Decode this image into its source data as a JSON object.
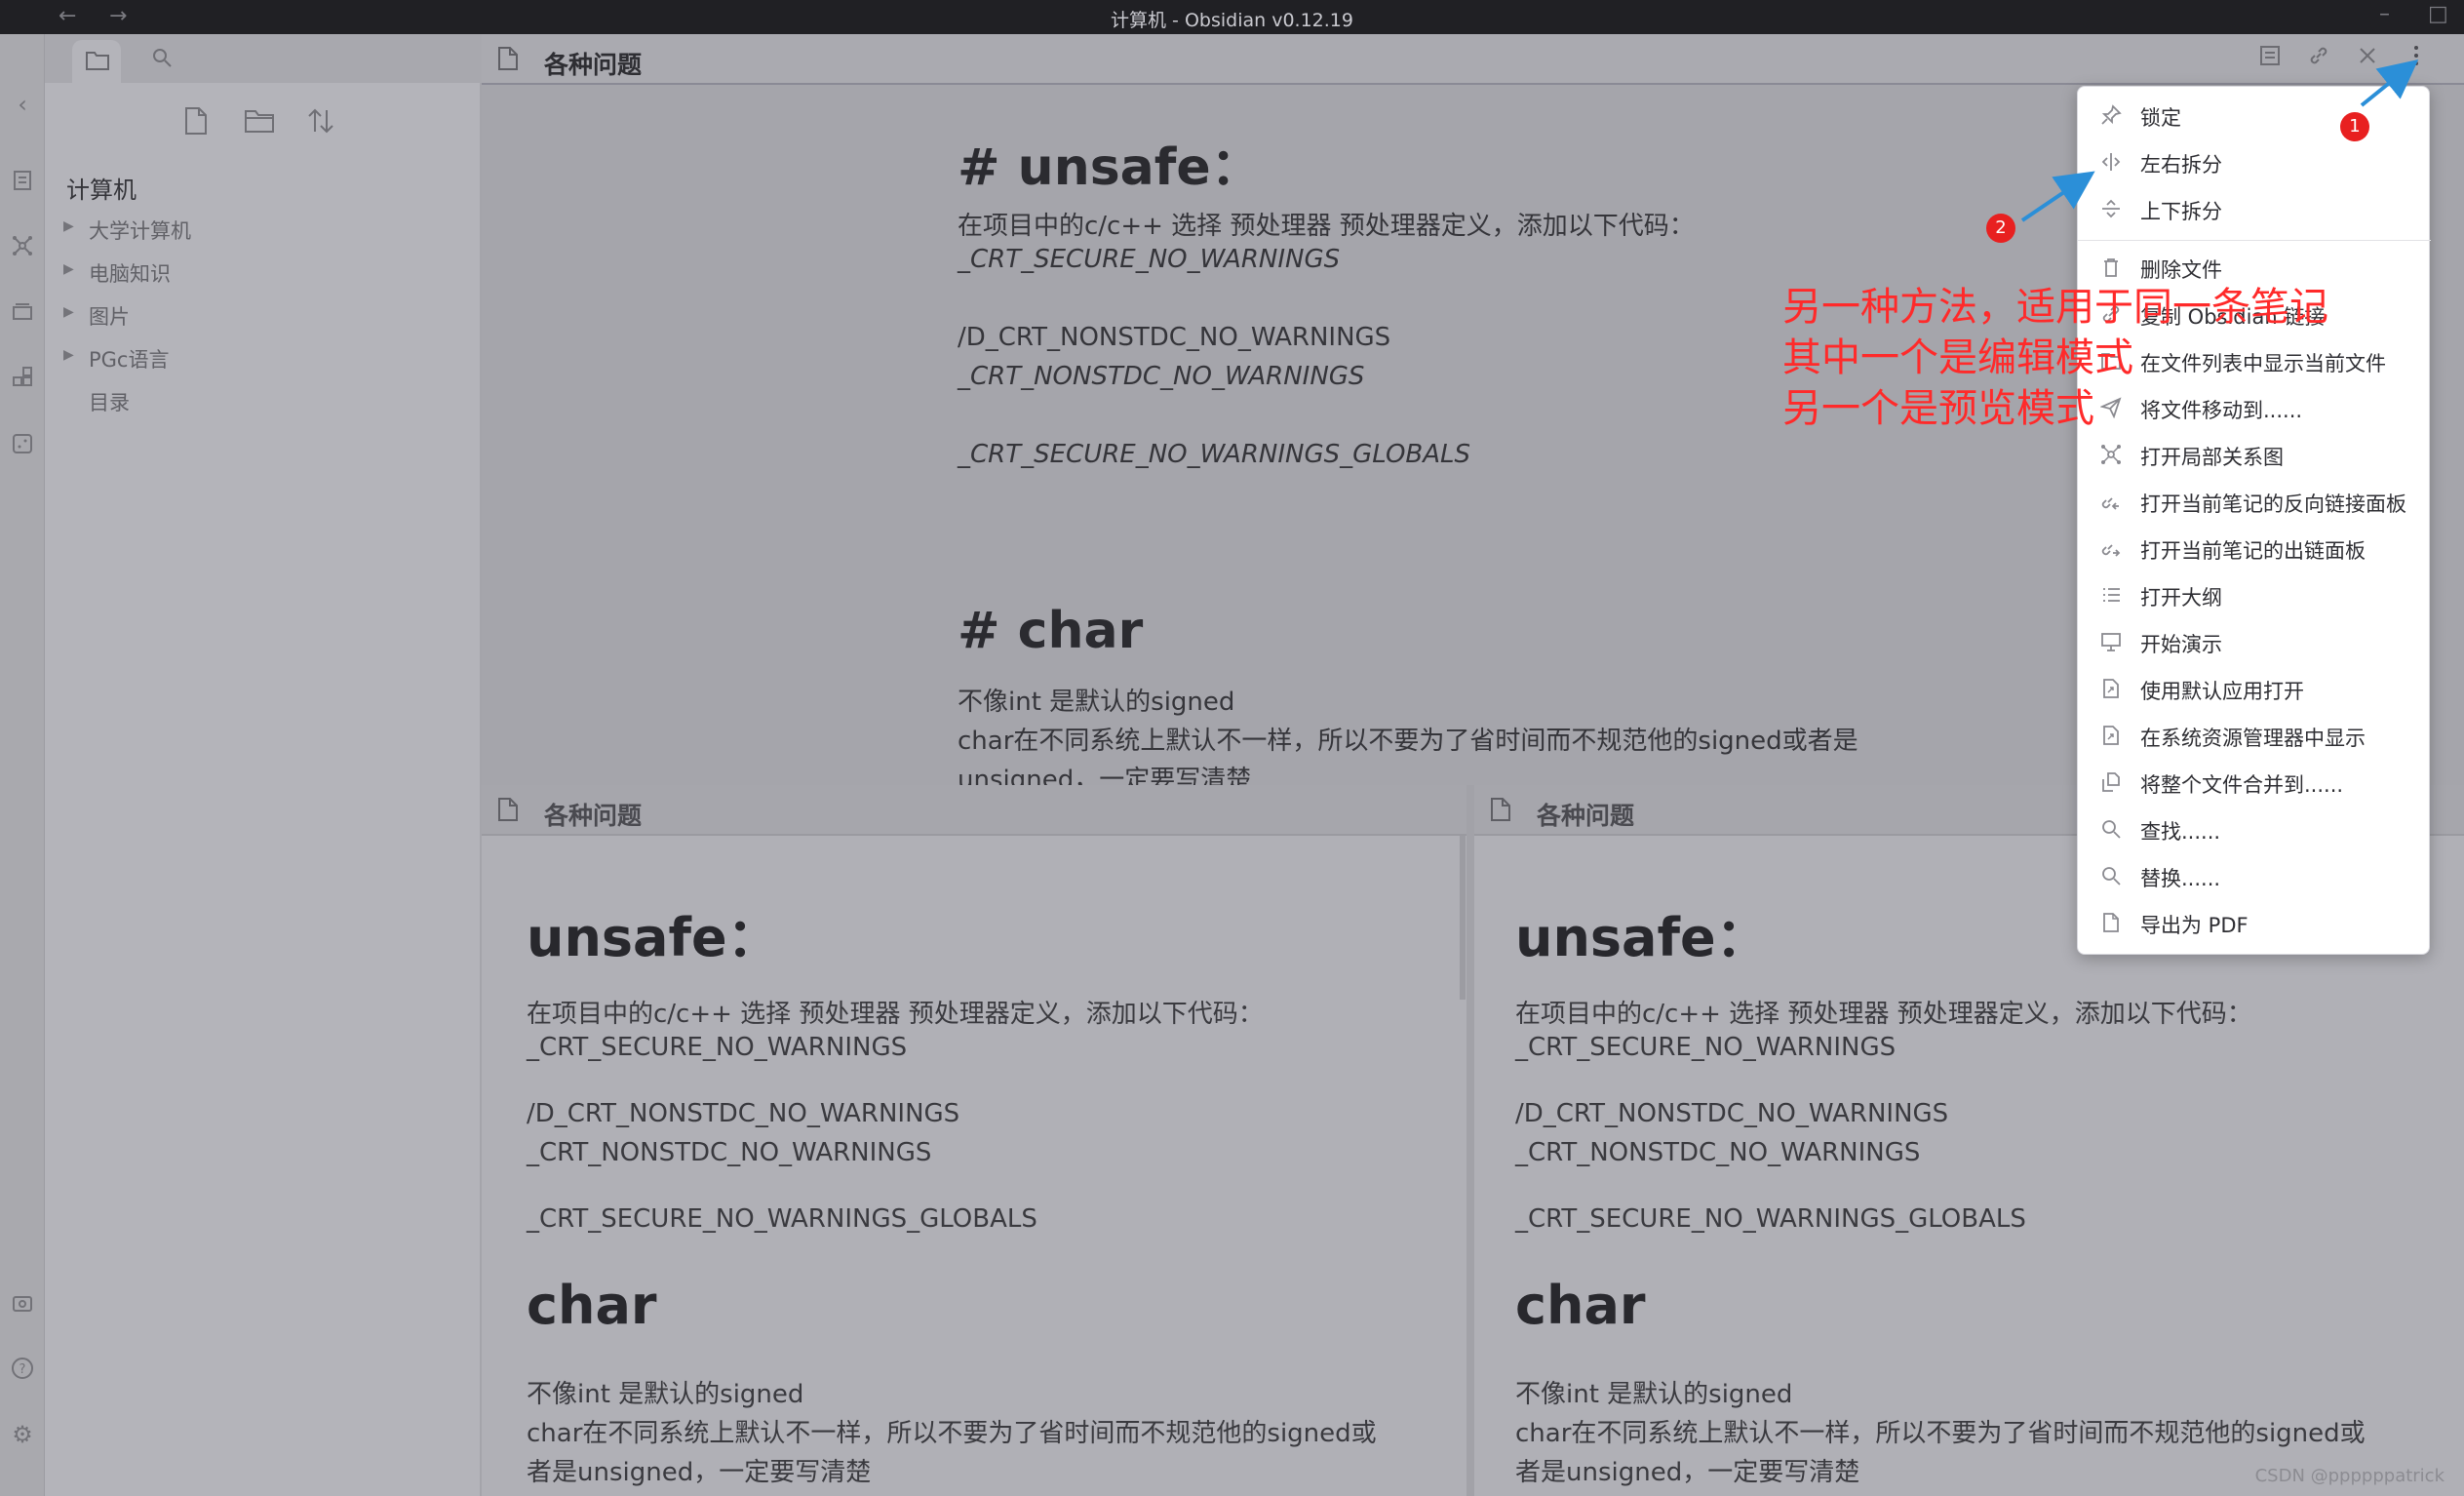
{
  "window": {
    "title": "计算机 - Obsidian v0.12.19",
    "back": "←",
    "forward": "→"
  },
  "sidebar": {
    "vault_name": "计算机",
    "items": [
      {
        "label": "大学计算机",
        "collapsed": true
      },
      {
        "label": "电脑知识",
        "collapsed": true
      },
      {
        "label": "图片",
        "collapsed": true
      },
      {
        "label": "PGc语言",
        "collapsed": true
      },
      {
        "label": "目录",
        "collapsed": false
      }
    ]
  },
  "top_pane": {
    "title": "各种问题",
    "lines": {
      "h_unsafe": "# unsafe：",
      "p1": "在项目中的c/c++ 选择 预处理器 预处理器定义，添加以下代码：",
      "p2": "_CRT_SECURE_NO_WARNINGS",
      "p3": "/D_CRT_NONSTDC_NO_WARNINGS",
      "p4": "_CRT_NONSTDC_NO_WARNINGS",
      "p5": "_CRT_SECURE_NO_WARNINGS_GLOBALS",
      "h_char": "# char",
      "p6": "不像int 是默认的signed",
      "p7": "char在不同系统上默认不一样，所以不要为了省时间而不规范他的signed或者是",
      "p8": "unsigned，一定要写清楚"
    }
  },
  "bottom_left": {
    "title": "各种问题",
    "h_unsafe": "unsafe：",
    "p1": "在项目中的c/c++ 选择 预处理器 预处理器定义，添加以下代码：",
    "p2": "_CRT_SECURE_NO_WARNINGS",
    "p3": "/D_CRT_NONSTDC_NO_WARNINGS",
    "p4": "_CRT_NONSTDC_NO_WARNINGS",
    "p5": "_CRT_SECURE_NO_WARNINGS_GLOBALS",
    "h_char": "char",
    "p6": "不像int 是默认的signed",
    "p7": "char在不同系统上默认不一样，所以不要为了省时间而不规范他的signed或",
    "p8": "者是unsigned，一定要写清楚"
  },
  "bottom_right": {
    "title": "各种问题",
    "h_unsafe": "unsafe：",
    "p1": "在项目中的c/c++ 选择 预处理器 预处理器定义，添加以下代码：",
    "p2": "_CRT_SECURE_NO_WARNINGS",
    "p3": "/D_CRT_NONSTDC_NO_WARNINGS",
    "p4": "_CRT_NONSTDC_NO_WARNINGS",
    "p5": "_CRT_SECURE_NO_WARNINGS_GLOBALS",
    "h_char": "char",
    "p6": "不像int 是默认的signed",
    "p7": "char在不同系统上默认不一样，所以不要为了省时间而不规范他的signed或",
    "p8": "者是unsigned，一定要写清楚"
  },
  "menu": {
    "items": [
      {
        "label": "锁定",
        "icon": "pin-icon"
      },
      {
        "label": "左右拆分",
        "icon": "split-vertical-icon"
      },
      {
        "label": "上下拆分",
        "icon": "split-horizontal-icon"
      },
      {
        "label": "删除文件",
        "icon": "trash-icon"
      },
      {
        "label": "复制 Obsidian 链接",
        "icon": "link-icon"
      },
      {
        "label": "在文件列表中显示当前文件",
        "icon": "folder-reveal-icon"
      },
      {
        "label": "将文件移动到......",
        "icon": "paper-plane-icon"
      },
      {
        "label": "打开局部关系图",
        "icon": "graph-icon"
      },
      {
        "label": "打开当前笔记的反向链接面板",
        "icon": "backlinks-icon"
      },
      {
        "label": "打开当前笔记的出链面板",
        "icon": "outgoing-links-icon"
      },
      {
        "label": "打开大纲",
        "icon": "outline-icon"
      },
      {
        "label": "开始演示",
        "icon": "presentation-icon"
      },
      {
        "label": "使用默认应用打开",
        "icon": "open-external-icon"
      },
      {
        "label": "在系统资源管理器中显示",
        "icon": "explorer-icon"
      },
      {
        "label": "将整个文件合并到......",
        "icon": "merge-icon"
      },
      {
        "label": "查找......",
        "icon": "search-icon"
      },
      {
        "label": "替换......",
        "icon": "replace-icon"
      },
      {
        "label": "导出为 PDF",
        "icon": "pdf-icon"
      }
    ]
  },
  "annotations": {
    "badge1": "1",
    "badge2": "2",
    "line1": "另一种方法，适用于同一条笔记",
    "line2": "其中一个是编辑模式",
    "line3": "另一个是预览模式",
    "accent": "#ff2a2a",
    "arrow_color": "#2b8fd8"
  },
  "watermark": "CSDN @ppppppatrick"
}
